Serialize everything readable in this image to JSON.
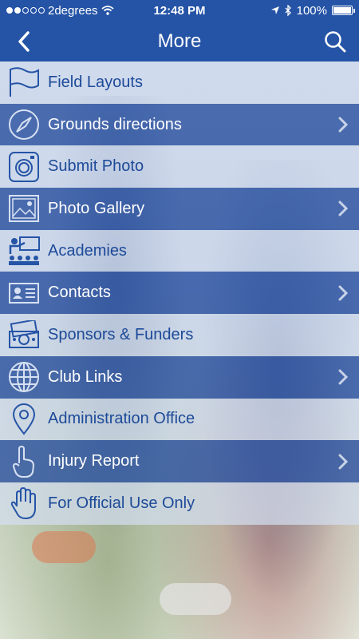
{
  "status_bar": {
    "carrier": "2degrees",
    "time": "12:48 PM",
    "battery": "100%"
  },
  "header": {
    "title": "More"
  },
  "menu": {
    "items": [
      {
        "label": "Field Layouts",
        "icon": "flag-icon",
        "chevron": false
      },
      {
        "label": "Grounds directions",
        "icon": "compass-icon",
        "chevron": true
      },
      {
        "label": "Submit Photo",
        "icon": "camera-icon",
        "chevron": false
      },
      {
        "label": "Photo Gallery",
        "icon": "image-icon",
        "chevron": true
      },
      {
        "label": "Academies",
        "icon": "classroom-icon",
        "chevron": false
      },
      {
        "label": "Contacts",
        "icon": "contact-card-icon",
        "chevron": true
      },
      {
        "label": "Sponsors & Funders",
        "icon": "money-icon",
        "chevron": false
      },
      {
        "label": "Club Links",
        "icon": "globe-icon",
        "chevron": true
      },
      {
        "label": "Administration Office",
        "icon": "location-pin-icon",
        "chevron": false
      },
      {
        "label": "Injury Report",
        "icon": "pointing-hand-icon",
        "chevron": true
      },
      {
        "label": "For Official Use Only",
        "icon": "hand-icon",
        "chevron": false
      }
    ]
  },
  "colors": {
    "header_bg": "#2554a6",
    "row_dark": "#2850a0",
    "row_light": "#d2def0",
    "text_blue": "#1d4a99"
  }
}
